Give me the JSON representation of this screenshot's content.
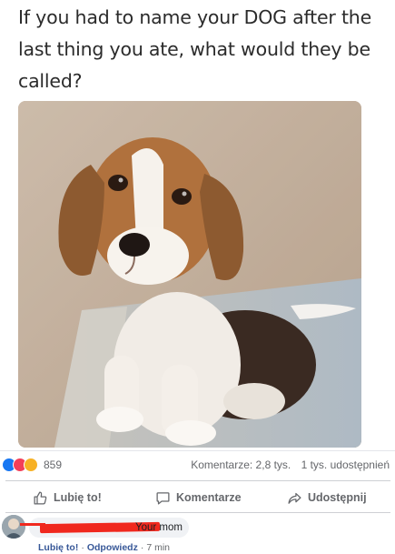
{
  "post": {
    "text": "If you had to name your DOG after the last thing you ate, what would they be called?"
  },
  "reactions": {
    "icons": [
      "like-icon",
      "love-icon",
      "haha-icon"
    ],
    "count": "859",
    "comments": "Komentarze: 2,8 tys.",
    "shares": "1 tys. udostępnień"
  },
  "actions": {
    "like": "Lubię to!",
    "comment": "Komentarze",
    "share": "Udostępnij"
  },
  "comment": {
    "text": "Your mom",
    "like": "Lubię to!",
    "reply": "Odpowiedz",
    "time": "7 min",
    "sep": "·"
  },
  "colors": {
    "like": "#1877f2",
    "love": "#f33e58",
    "haha": "#f7b125",
    "redaction": "#f0281e"
  }
}
